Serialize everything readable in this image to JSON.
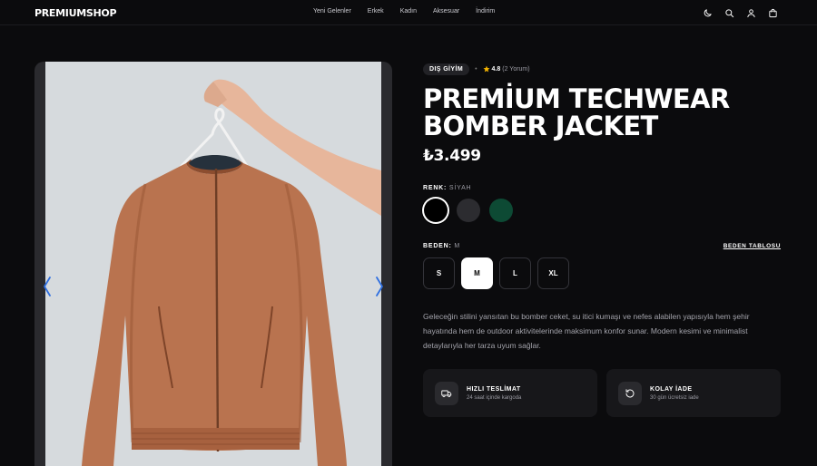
{
  "header": {
    "logo": "PREMIUMSHOP",
    "nav": [
      "Yeni Gelenler",
      "Erkek",
      "Kadın",
      "Aksesuar",
      "İndirim"
    ],
    "icons": [
      "theme-toggle-icon",
      "search-icon",
      "user-icon",
      "cart-icon"
    ]
  },
  "gallery": {
    "prev_icon": "chevron-left-icon",
    "next_icon": "chevron-right-icon",
    "accent": "#2f6fe0"
  },
  "product": {
    "category": "DIŞ GİYİM",
    "rating": "4.8",
    "reviews": "(2 Yorum)",
    "title_line1": "PREMİUM TECHWEAR",
    "title_line2": "BOMBER JACKET",
    "price": "₺3.499",
    "color_label": "RENK:",
    "color_value": "SİYAH",
    "colors": [
      "#000000",
      "#2c2c30",
      "#0d4a34"
    ],
    "size_label": "BEDEN:",
    "size_value": "M",
    "size_guide": "BEDEN TABLOSU",
    "sizes": [
      "S",
      "M",
      "L",
      "XL"
    ],
    "description": "Geleceğin stilini yansıtan bu bomber ceket, su itici kumaşı ve nefes alabilen yapısıyla hem şehir hayatında hem de outdoor aktivitelerinde maksimum konfor sunar. Modern kesimi ve minimalist detaylarıyla her tarza uyum sağlar."
  },
  "features": [
    {
      "icon": "truck-icon",
      "title": "HIZLI TESLİMAT",
      "subtitle": "24 saat içinde kargoda"
    },
    {
      "icon": "return-icon",
      "title": "KOLAY İADE",
      "subtitle": "30 gün ücretsiz iade"
    }
  ]
}
